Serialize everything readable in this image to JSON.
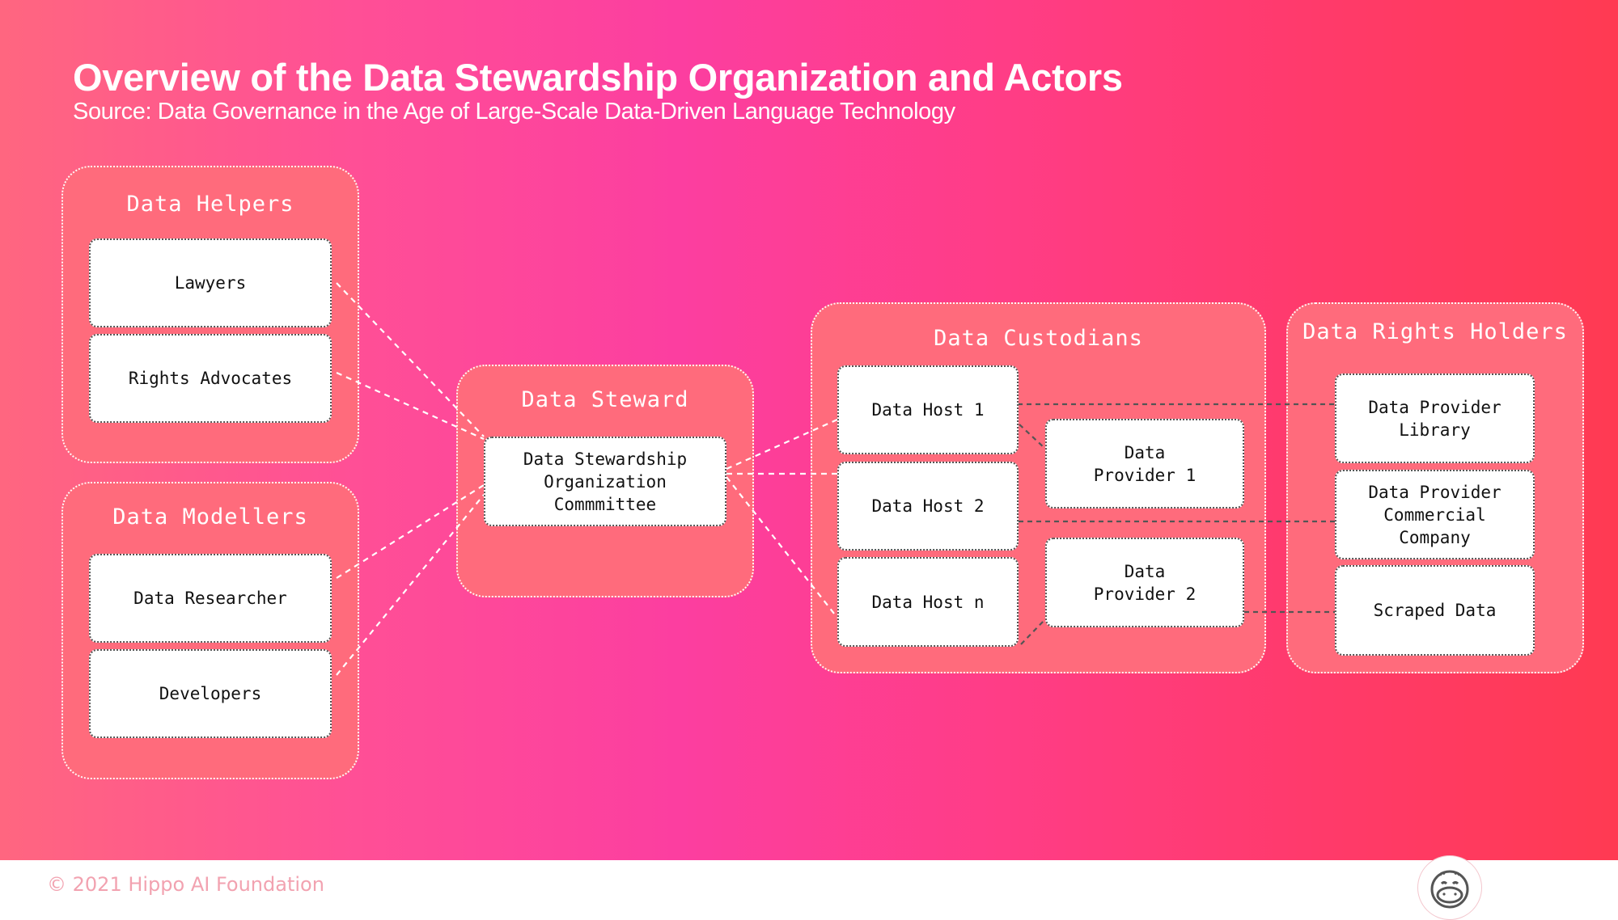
{
  "slide": {
    "title": "Overview of the Data Stewardship Organization and Actors",
    "subtitle": "Source: Data Governance in the Age of Large-Scale Data-Driven Language Technology"
  },
  "groups": {
    "data_helpers": {
      "title": "Data Helpers",
      "members": [
        "Lawyers",
        "Rights Advocates"
      ]
    },
    "data_modellers": {
      "title": "Data Modellers",
      "members": [
        "Data Researcher",
        "Developers"
      ]
    },
    "data_steward": {
      "title": "Data Steward",
      "members": [
        "Data Stewardship\nOrganization\nCommmittee"
      ]
    },
    "data_custodians": {
      "title": "Data Custodians",
      "hosts": [
        "Data Host 1",
        "Data Host 2",
        "Data Host n"
      ],
      "providers": [
        "Data\nProvider 1",
        "Data\nProvider 2"
      ]
    },
    "data_rights_holders": {
      "title": "Data Rights Holders",
      "members": [
        "Data Provider\nLibrary",
        "Data Provider\nCommercial\nCompany",
        "Scraped Data"
      ]
    }
  },
  "connections": [
    {
      "from": "Lawyers",
      "to": "Data Stewardship Organization Commmittee",
      "style": "white-dashed"
    },
    {
      "from": "Rights Advocates",
      "to": "Data Stewardship Organization Commmittee",
      "style": "white-dashed"
    },
    {
      "from": "Data Researcher",
      "to": "Data Stewardship Organization Commmittee",
      "style": "white-dashed"
    },
    {
      "from": "Developers",
      "to": "Data Stewardship Organization Commmittee",
      "style": "white-dashed"
    },
    {
      "from": "Data Stewardship Organization Commmittee",
      "to": "Data Host 1",
      "style": "white-dashed"
    },
    {
      "from": "Data Stewardship Organization Commmittee",
      "to": "Data Host 2",
      "style": "white-dashed"
    },
    {
      "from": "Data Stewardship Organization Commmittee",
      "to": "Data Host n",
      "style": "white-dashed"
    },
    {
      "from": "Data Host 1",
      "to": "Data Provider 1",
      "style": "gray-dashed"
    },
    {
      "from": "Data Host n",
      "to": "Data Provider 2",
      "style": "gray-dashed"
    },
    {
      "from": "Data Host 1",
      "to": "Data Provider Library",
      "style": "gray-dashed"
    },
    {
      "from": "Data Host 2",
      "to": "Data Provider Commercial Company",
      "style": "gray-dashed"
    },
    {
      "from": "Data Provider 2",
      "to": "Scraped Data",
      "style": "gray-dashed"
    }
  ],
  "colors": {
    "gradient_left": "#ff6680",
    "gradient_mid": "#fc3ea0",
    "gradient_right": "#ff3a52",
    "group_fill": "#ff6b7c",
    "node_fill": "#ffffff",
    "node_border": "#555555"
  },
  "footer": {
    "copyright": "© 2021 Hippo AI Foundation",
    "logo_icon": "hippo-icon"
  }
}
